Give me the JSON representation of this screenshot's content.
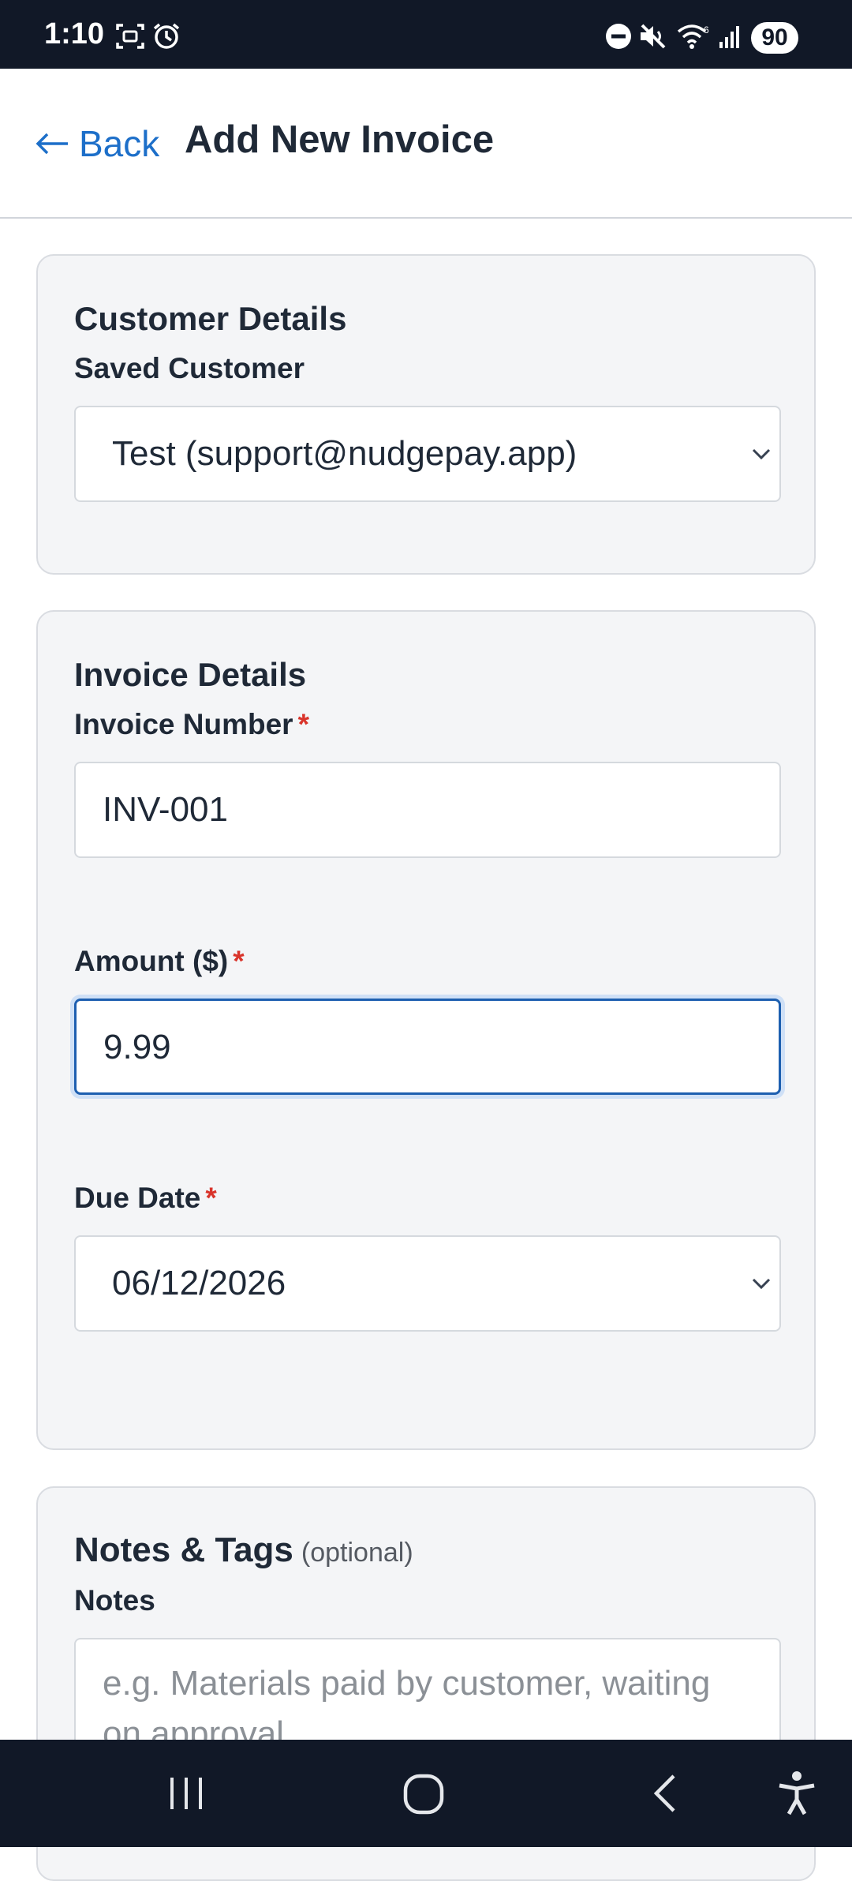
{
  "status_bar": {
    "time": "1:10",
    "battery": "90",
    "icons": [
      "screenshot-icon",
      "alarm-icon",
      "dnd-icon",
      "mute-icon",
      "wifi-icon",
      "signal-icon"
    ]
  },
  "header": {
    "back_label": "Back",
    "title": "Add New Invoice"
  },
  "customer_card": {
    "title": "Customer Details",
    "saved_customer_label": "Saved Customer",
    "saved_customer_value": "Test (support@nudgepay.app)"
  },
  "invoice_card": {
    "title": "Invoice Details",
    "invoice_number_label": "Invoice Number",
    "invoice_number_value": "INV-001",
    "amount_label": "Amount ($)",
    "amount_value": "9.99",
    "due_date_label": "Due Date",
    "due_date_value": "06/12/2026",
    "required_mark": "*"
  },
  "notes_card": {
    "title": "Notes & Tags",
    "optional_label": "(optional)",
    "notes_label": "Notes",
    "notes_placeholder": "e.g. Materials paid by customer, waiting on approval"
  },
  "colors": {
    "accent": "#1d6fc9",
    "required": "#d9342b",
    "card_bg": "#f4f5f7",
    "system_bar": "#111827"
  },
  "nav_bar": {
    "icons": [
      "recents-icon",
      "home-icon",
      "back-icon",
      "accessibility-icon"
    ]
  }
}
